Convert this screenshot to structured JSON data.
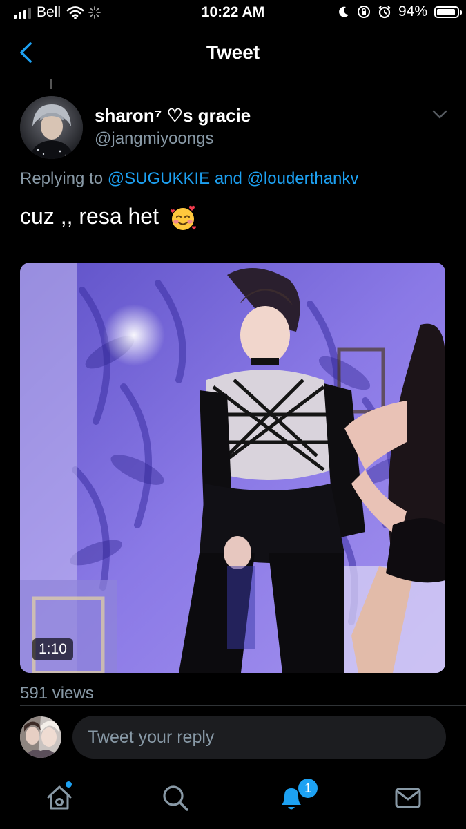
{
  "status_bar": {
    "carrier": "Bell",
    "time": "10:22 AM",
    "battery_percent": "94%",
    "battery_level": 0.94,
    "icons": [
      "wifi-icon",
      "loading-icon",
      "moon-icon",
      "rotation-lock-icon",
      "alarm-icon",
      "battery-icon"
    ]
  },
  "header": {
    "title": "Tweet",
    "back_icon": "chevron-left-icon"
  },
  "tweet": {
    "display_name": "sharon⁷ ♡s gracie",
    "handle": "@jangmiyoongs",
    "replying_prefix": "Replying to",
    "mention_1": "@SUGUKKIE",
    "replying_and": "and",
    "mention_2": "@louderthankv",
    "text": "cuz ,, resa het",
    "emoji": "smiling-face-with-hearts",
    "video_duration": "1:10",
    "views": "591 views"
  },
  "reply": {
    "placeholder": "Tweet your reply"
  },
  "tabs": [
    {
      "name": "home",
      "icon": "home-icon",
      "has_dot": true
    },
    {
      "name": "search",
      "icon": "search-icon"
    },
    {
      "name": "notifications",
      "icon": "bell-icon",
      "badge": "1"
    },
    {
      "name": "messages",
      "icon": "mail-icon"
    }
  ],
  "colors": {
    "background": "#000000",
    "accent": "#1da1f2",
    "secondary_text": "#8899a6"
  }
}
